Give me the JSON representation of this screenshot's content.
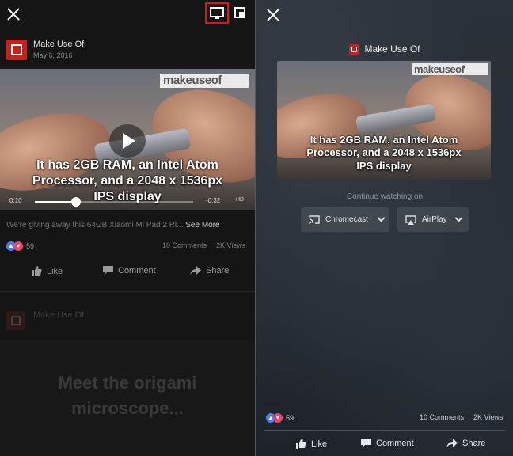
{
  "left": {
    "page_name": "Make Use Of",
    "post_date": "May 6, 2016",
    "watermark": "makeuseof",
    "video_caption_lines": [
      "It has 2GB RAM, an Intel Atom",
      "Processor, and a 2048 x 1536px",
      "IPS display"
    ],
    "time_elapsed": "0:10",
    "time_remaining": "-0:32",
    "quality_badge": "HD",
    "progress": 0.26,
    "post_text": "We're giving away this 64GB Xiaomi Mi Pad 2 Ri...",
    "see_more": "See More",
    "reactions_count": "59",
    "comments_count": "10 Comments",
    "views_count": "2K Views",
    "actions": {
      "like": "Like",
      "comment": "Comment",
      "share": "Share"
    },
    "next_post_page": "Make Use Of",
    "next_post_title_lines": [
      "Meet the origami",
      "microscope..."
    ]
  },
  "right": {
    "page_name": "Make Use Of",
    "watermark": "makeuseof",
    "video_caption_lines": [
      "It has 2GB RAM, an Intel Atom",
      "Processor, and a 2048 x 1536px",
      "IPS display"
    ],
    "continue_label": "Continue watching on",
    "cast_options": [
      "Chromecast",
      "AirPlay"
    ],
    "reactions_count": "59",
    "comments_count": "10 Comments",
    "views_count": "2K Views",
    "actions": {
      "like": "Like",
      "comment": "Comment",
      "share": "Share"
    }
  },
  "colors": {
    "brand": "#c8211d",
    "like_blue": "#4a7ff5",
    "love_red": "#f0446b",
    "highlight_box": "#e0141e"
  },
  "icons": [
    "close-icon",
    "tv-cast-icon",
    "picture-in-picture-icon",
    "play-icon",
    "chromecast-icon",
    "airplay-icon",
    "like-icon",
    "comment-icon",
    "share-icon"
  ]
}
